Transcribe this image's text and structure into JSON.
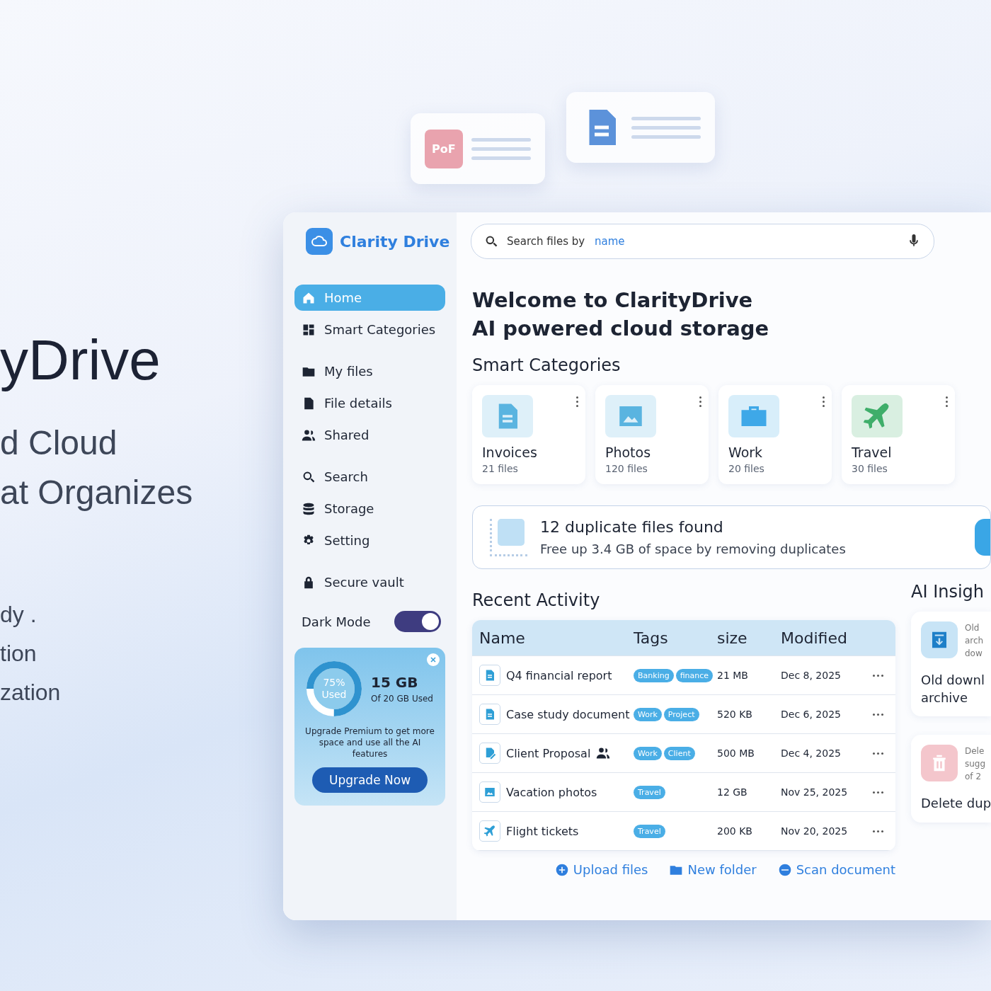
{
  "hero": {
    "title": "yDrive",
    "lines": [
      "d Cloud",
      "at Organizes"
    ],
    "bullets": [
      "dy .",
      "tion",
      "zation"
    ]
  },
  "floating_cards": [
    {
      "kind": "pdf",
      "label": "PoF"
    },
    {
      "kind": "doc"
    }
  ],
  "app": {
    "brand": "Clarity Drive",
    "search": {
      "placeholder": "Search files by",
      "hint": "name"
    },
    "sidebar": {
      "items": [
        {
          "label": "Home",
          "selected": true
        },
        {
          "label": "Smart Categories",
          "selected": false
        },
        {
          "label": "My files",
          "selected": false
        },
        {
          "label": "File details",
          "selected": false
        },
        {
          "label": "Shared",
          "selected": false
        },
        {
          "label": "Search",
          "selected": false
        },
        {
          "label": "Storage",
          "selected": false
        },
        {
          "label": "Setting",
          "selected": false
        },
        {
          "label": "Secure vault",
          "selected": false
        }
      ],
      "dark_mode": {
        "label": "Dark Mode",
        "on": true
      },
      "storage_card": {
        "percent": "75%",
        "used": "Used",
        "level": 0.75,
        "amount": "15 GB",
        "of_total": "Of 20 GB Used",
        "message": "Upgrade Premium to get more space and use all the AI features",
        "button": "Upgrade Now"
      }
    },
    "welcome": [
      "Welcome to ClarityDrive",
      "AI powered cloud storage"
    ],
    "categories": {
      "title": "Smart Categories",
      "items": [
        {
          "name": "Invoices",
          "count": "21 files",
          "color": "#5ab4e0"
        },
        {
          "name": "Photos",
          "count": "120 files",
          "color": "#5ab4e0"
        },
        {
          "name": "Work",
          "count": "20 files",
          "color": "#3ea8e8"
        },
        {
          "name": "Travel",
          "count": "30 files",
          "color": "#3fae6a"
        }
      ]
    },
    "duplicates": {
      "title": "12 duplicate files found",
      "subtitle": "Free up 3.4 GB of space by removing duplicates"
    },
    "recent": {
      "title": "Recent Activity",
      "columns": [
        "Name",
        "Tags",
        "size",
        "Modified"
      ],
      "rows": [
        {
          "name": "Q4 financial report",
          "shared": false,
          "tags": [
            "Banking",
            "finance"
          ],
          "size": "21 MB",
          "modified": "Dec 8, 2025"
        },
        {
          "name": "Case study document",
          "shared": false,
          "tags": [
            "Work",
            "Project"
          ],
          "size": "520 KB",
          "modified": "Dec 6, 2025"
        },
        {
          "name": "Client Proposal",
          "shared": true,
          "tags": [
            "Work",
            "Client"
          ],
          "size": "500 MB",
          "modified": "Dec 4, 2025"
        },
        {
          "name": "Vacation photos",
          "shared": false,
          "tags": [
            "Travel"
          ],
          "size": "12 GB",
          "modified": "Nov 25, 2025"
        },
        {
          "name": "Flight tickets",
          "shared": false,
          "tags": [
            "Travel"
          ],
          "size": "200 KB",
          "modified": "Nov 20, 2025"
        }
      ]
    },
    "ai_insights": {
      "title": "AI Insigh",
      "cards": [
        {
          "kind": "archive",
          "desc": [
            "Old",
            "arch",
            "dow"
          ],
          "title": [
            "Old downl",
            "archive"
          ]
        },
        {
          "kind": "delete",
          "desc": [
            "Dele",
            "sugg",
            "of 2"
          ],
          "title": [
            "Delete dup"
          ]
        }
      ]
    },
    "actions": [
      {
        "label": "Upload files"
      },
      {
        "label": "New folder"
      },
      {
        "label": "Scan document"
      }
    ]
  }
}
